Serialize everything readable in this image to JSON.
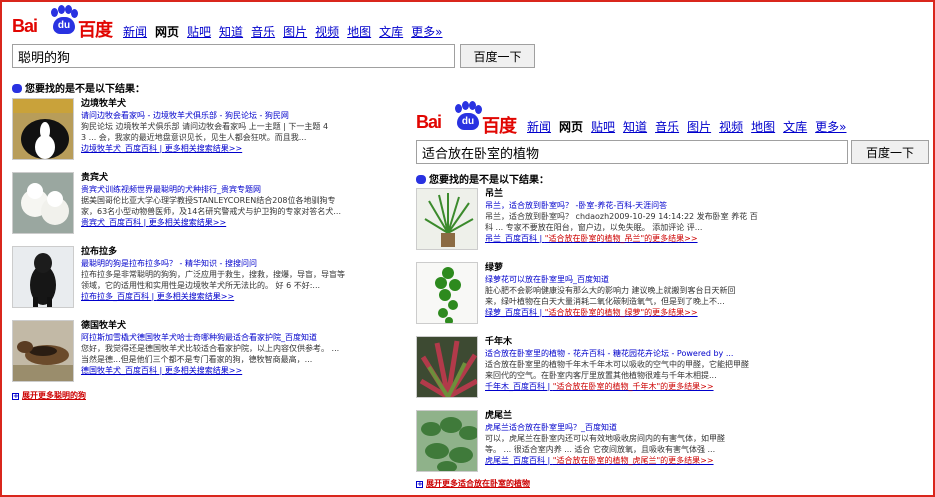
{
  "left": {
    "logo": {
      "bai": "Bai",
      "du": "百度",
      "paw": "du"
    },
    "nav": [
      "新闻",
      "网页",
      "贴吧",
      "知道",
      "音乐",
      "图片",
      "视频",
      "地图",
      "文库",
      "更多»"
    ],
    "query": "聪明的狗",
    "button": "百度一下",
    "suggest": "您要找的是不是以下结果：",
    "items": [
      {
        "title": "边境牧羊犬",
        "link": "请问边牧会看家吗 - 边境牧羊犬俱乐部 - 狗民论坛 - 狗民网",
        "desc1": "狗民论坛  边境牧羊犬俱乐部  请问边牧会看家吗  上一主题 | 下一主题 4",
        "desc2": "3 ... 会，我家的最近地盘意识见长，见生人都会狂吠。而且我...",
        "foot1": "边境牧羊犬_百度百科",
        "foot2": "更多相关搜索结果>>"
      },
      {
        "title": "贵宾犬",
        "link": "贵宾犬训练视频世界最聪明的犬种排行_贵宾专题网",
        "desc1": "据美国哥伦比亚大学心理学教授STANLEYCOREN结合208位各地驯狗专",
        "desc2": "家，63名小型动物兽医师，及14名研究警戒犬与护卫狗的专家对答名犬...",
        "foot1": "贵宾犬_百度百科",
        "foot2": "更多相关搜索结果>>"
      },
      {
        "title": "拉布拉多",
        "link": "最聪明的狗是拉布拉多吗？ - 精华知识 - 搜搜问问",
        "desc1": "拉布拉多是非常聪明的狗狗，广泛应用于救生，搜救，搜爆，导盲，导盲等",
        "desc2": "领域，它的适用性和实用性是边境牧羊犬所无法比的。  好 6 不好:...",
        "foot1": "拉布拉多_百度百科",
        "foot2": "更多相关搜索结果>>"
      },
      {
        "title": "德国牧羊犬",
        "link": "阿拉斯加雪橇犬德国牧羊犬哈士奇哪种狗最适合看家护院_百度知道",
        "desc1": "您好，我觉得还是德国牧羊犬比较适合看家护院，以上内容仅供参考。   ...",
        "desc2": "当然是德...但是他们三个都不是专门看家的狗，德牧智商最高，...",
        "foot1": "德国牧羊犬_百度百科",
        "foot2": "更多相关搜索结果>>"
      }
    ],
    "more": "展开更多聪明的狗"
  },
  "right": {
    "logo": {
      "bai": "Bai",
      "du": "百度",
      "paw": "du"
    },
    "nav": [
      "新闻",
      "网页",
      "贴吧",
      "知道",
      "音乐",
      "图片",
      "视频",
      "地图",
      "文库",
      "更多»"
    ],
    "query": "适合放在卧室的植物",
    "button": "百度一下",
    "suggest": "您要找的是不是以下结果：",
    "items": [
      {
        "title": "吊兰",
        "link": "吊兰，适合放到卧室吗？ -卧室-养花-百科-天涯问答",
        "desc1": "吊兰，适合放到卧室吗？  chdaozh2009-10-29 14:14:22 发布卧室  养花  百",
        "desc2": "科 ... 专家不要放在阳台，窗户边，以免失眠。 添加评论  评...",
        "foot1": "吊兰_百度百科",
        "foot2": "\"适合放在卧室的植物_吊兰\"的更多结果>>"
      },
      {
        "title": "绿萝",
        "link": "绿萝花可以放在卧室里吗_百度知道",
        "desc1": "脏心肥不会影响健康没有那么大的影响力  建议晚上就搬到客台日天新回",
        "desc2": "来，绿叶植物在白天大量消耗二氧化碳制造氧气，但是到了晚上不...",
        "foot1": "绿萝_百度百科",
        "foot2": "\"适合放在卧室的植物_绿萝\"的更多结果>>"
      },
      {
        "title": "千年木",
        "link": "适合放在卧室里的植物 - 花卉百科 - 糖花园花卉论坛 - Powered by ...",
        "desc1": "适合放在卧室里的植物千年木千年木可以吸收的空气中的甲醛，它能把甲醛",
        "desc2": "来回代的空气。在卧室内客厅里放置其他植物很难与千年木相提...",
        "foot1": "千年木_百度百科",
        "foot2": "\"适合放在卧室的植物_千年木\"的更多结果>>"
      },
      {
        "title": "虎尾兰",
        "link": "虎尾兰适合放在卧室里吗？_百度知道",
        "desc1": "可以，虎尾兰在卧室内还可以有效地吸收房间内的有害气体，如甲醛",
        "desc2": "等。 ... 很适合室内养 ... 适合  它夜间放氧，且吸收有害气体强 ...",
        "foot1": "虎尾兰_百度百科",
        "foot2": "\"适合放在卧室的植物_虎尾兰\"的更多结果>>"
      }
    ],
    "more": "展开更多适合放在卧室的植物"
  },
  "colors": {
    "frame": "#d9261c",
    "link": "#0000cc",
    "red": "#cc0000",
    "brand_blue": "#2932e1"
  }
}
